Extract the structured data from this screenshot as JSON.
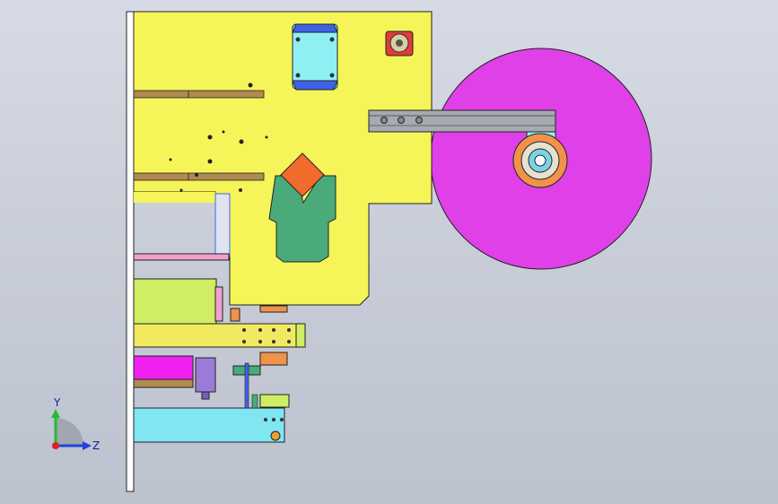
{
  "viewport": {
    "background_top": "#d7dbe5",
    "background_bottom": "#bcc2ce"
  },
  "colors": {
    "main_plate": "#f5f55a",
    "disc": "#e040e8",
    "bracket_green": "#4aaa7a",
    "block_cyan": "#8ff0f4",
    "block_blue": "#3f63e6",
    "slide_orange": "#f0924a",
    "rail_gray": "#a8aab2",
    "brown_bar": "#b08a50",
    "lime_block": "#cfee63",
    "magenta_block": "#f020f0",
    "cyan_bar": "#7fe6f2",
    "yellow_bar": "#f1e960",
    "pink_strip": "#f0a0d0",
    "red_accent": "#e23b3b",
    "edge_line": "#2a2a2a"
  },
  "triad": {
    "y_label": "Y",
    "z_label": "Z",
    "y_axis_color": "#22bb33",
    "z_axis_color": "#2244dd",
    "origin_color": "#dd2222"
  },
  "icons": {
    "triad": "coordinate-triad-icon"
  }
}
